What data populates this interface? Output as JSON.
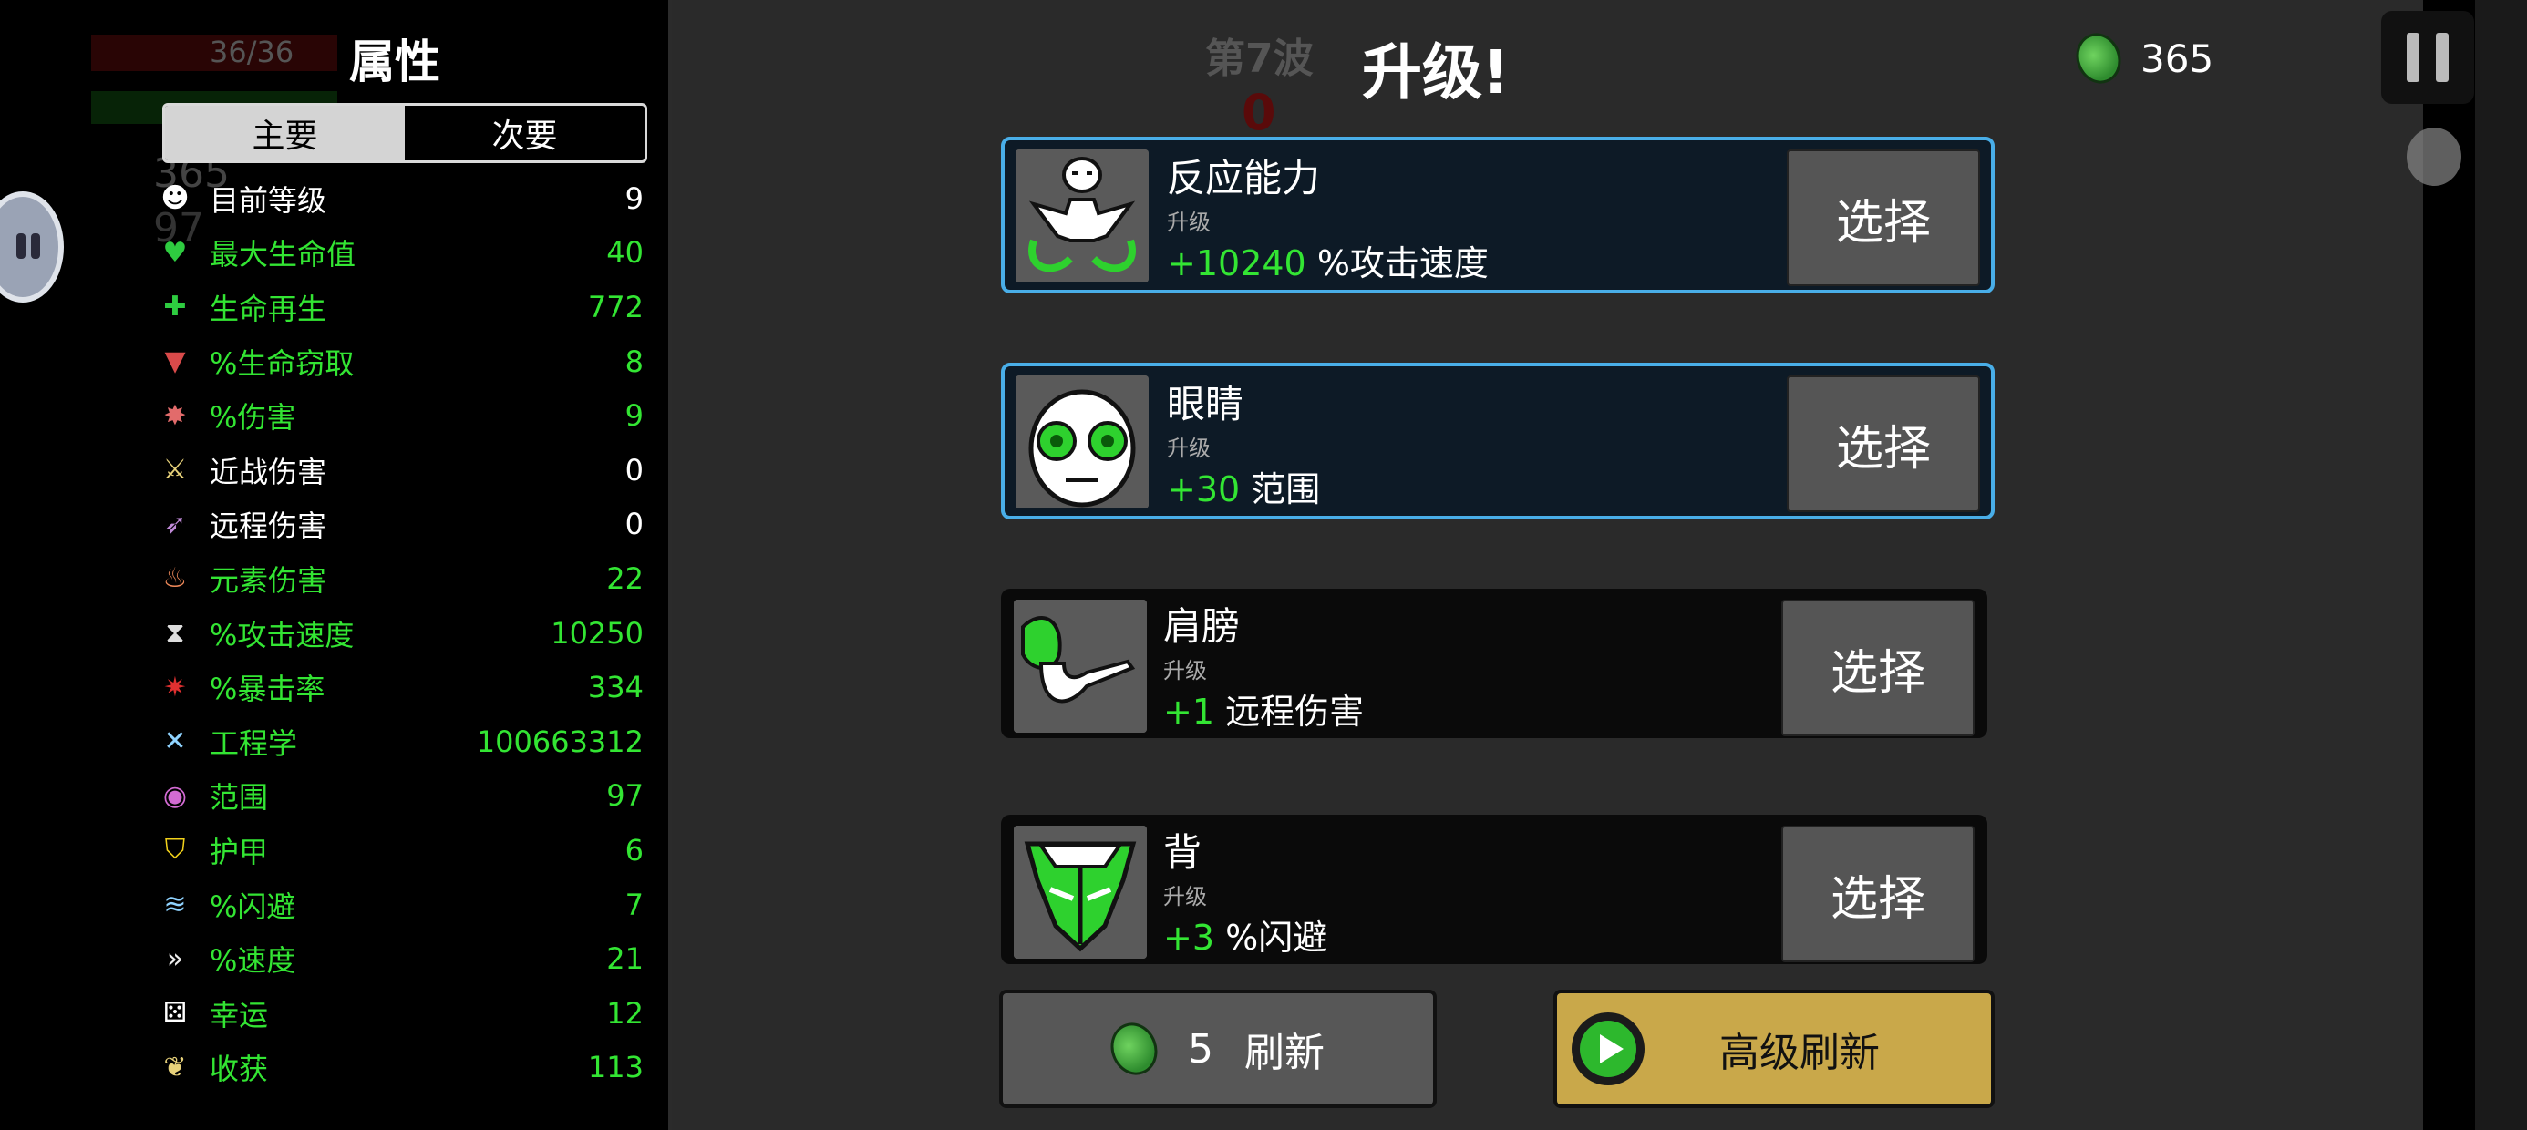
{
  "hud": {
    "hp_text": "36/36",
    "bg_coins": "365",
    "bg_bag": "97"
  },
  "stats_panel": {
    "title": "属性",
    "tabs": [
      {
        "label": "主要",
        "active": true
      },
      {
        "label": "次要",
        "active": false
      }
    ],
    "rows": [
      {
        "name": "目前等级",
        "value": "9",
        "color": "white",
        "icon": "level-icon"
      },
      {
        "name": "最大生命值",
        "value": "40",
        "color": "green",
        "icon": "heart-icon"
      },
      {
        "name": "生命再生",
        "value": "772",
        "color": "green",
        "icon": "regen-icon"
      },
      {
        "name": "%生命窃取",
        "value": "8",
        "color": "green",
        "icon": "lifesteal-icon"
      },
      {
        "name": "%伤害",
        "value": "9",
        "color": "green",
        "icon": "damage-icon"
      },
      {
        "name": "近战伤害",
        "value": "0",
        "color": "white",
        "icon": "melee-icon"
      },
      {
        "name": "远程伤害",
        "value": "0",
        "color": "white",
        "icon": "ranged-icon"
      },
      {
        "name": "元素伤害",
        "value": "22",
        "color": "green",
        "icon": "elemental-icon"
      },
      {
        "name": "%攻击速度",
        "value": "10250",
        "color": "green",
        "icon": "hourglass-icon"
      },
      {
        "name": "%暴击率",
        "value": "334",
        "color": "green",
        "icon": "crit-icon"
      },
      {
        "name": "工程学",
        "value": "100663312",
        "color": "green",
        "icon": "engineering-icon"
      },
      {
        "name": "范围",
        "value": "97",
        "color": "green",
        "icon": "range-icon"
      },
      {
        "name": "护甲",
        "value": "6",
        "color": "green",
        "icon": "shield-icon"
      },
      {
        "name": "%闪避",
        "value": "7",
        "color": "green",
        "icon": "dodge-icon"
      },
      {
        "name": "%速度",
        "value": "21",
        "color": "green",
        "icon": "speed-icon"
      },
      {
        "name": "幸运",
        "value": "12",
        "color": "green",
        "icon": "dice-icon"
      },
      {
        "name": "收获",
        "value": "113",
        "color": "green",
        "icon": "harvest-icon"
      }
    ]
  },
  "header": {
    "wave": "第7波",
    "timer": "0",
    "title": "升级!",
    "coins": "365"
  },
  "upgrades": [
    {
      "name": "反应能力",
      "kind": "升级",
      "amount": "+10240",
      "stat": "%攻击速度",
      "highlight": true,
      "icon": "reflexes-icon"
    },
    {
      "name": "眼睛",
      "kind": "升级",
      "amount": "+30",
      "stat": "范围",
      "highlight": true,
      "icon": "eyes-icon"
    },
    {
      "name": "肩膀",
      "kind": "升级",
      "amount": "+1",
      "stat": "远程伤害",
      "highlight": false,
      "icon": "shoulder-icon"
    },
    {
      "name": "背",
      "kind": "升级",
      "amount": "+3",
      "stat": "%闪避",
      "highlight": false,
      "icon": "back-icon"
    }
  ],
  "choose_label": "选择",
  "reroll": {
    "cost": "5",
    "label": "刷新"
  },
  "premium_reroll": {
    "label": "高级刷新"
  },
  "colors": {
    "accent_green": "#33e533",
    "highlight_border": "#49aee8",
    "premium_gold": "#c9a84a"
  }
}
